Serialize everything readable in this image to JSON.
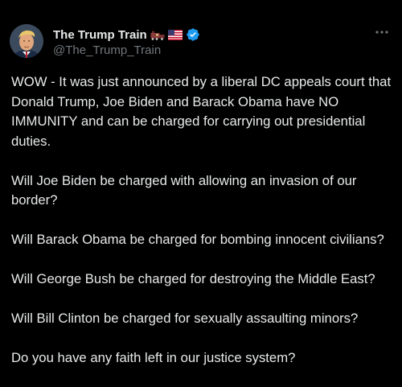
{
  "author": {
    "display_name": "The Trump Train",
    "handle": "@The_Trump_Train",
    "badges": [
      "train-emoji-icon",
      "us-flag-icon",
      "verified-badge-icon"
    ],
    "verified_color": "#1d9bf0"
  },
  "menu": {
    "more_icon": "more-horizontal-icon"
  },
  "tweet": {
    "paragraphs": [
      "WOW - It was just announced by a liberal DC appeals court that Donald Trump, Joe Biden and Barack Obama have NO IMMUNITY and can be charged for carrying out presidential duties.",
      "Will Joe Biden be charged with allowing an invasion of our border?",
      "Will Barack Obama be charged for bombing innocent civilians?",
      "Will George Bush be charged for destroying the Middle East?",
      "Will Bill Clinton be charged for sexually assaulting minors?",
      "Do you have any faith left in our justice system?"
    ]
  },
  "colors": {
    "background": "#000000",
    "primary_text": "#e7e9ea",
    "secondary_text": "#71767b"
  }
}
